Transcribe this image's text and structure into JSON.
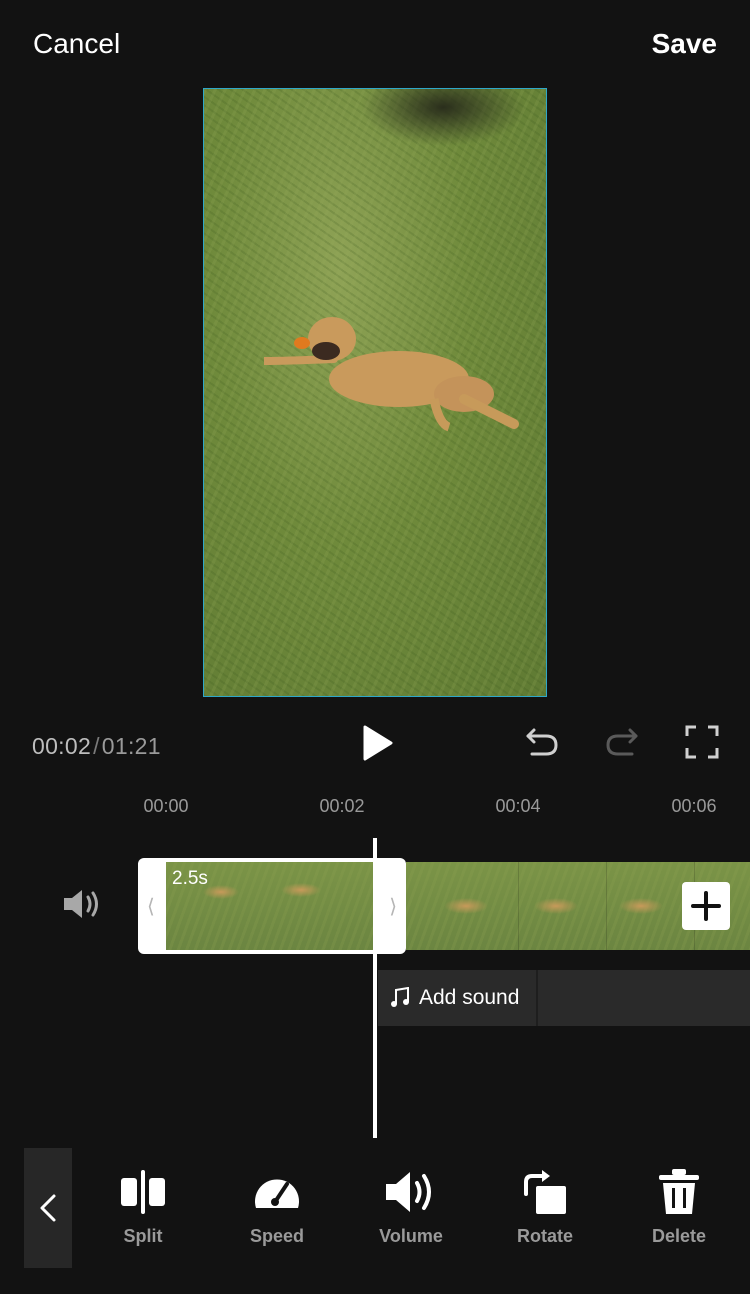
{
  "header": {
    "cancel_label": "Cancel",
    "save_label": "Save"
  },
  "playback": {
    "current_time": "00:02",
    "separator": "/",
    "total_time": "01:21"
  },
  "ruler": {
    "ticks": [
      "00:00",
      "00:02",
      "00:04",
      "00:06"
    ]
  },
  "timeline": {
    "clip_duration": "2.5s",
    "add_sound_label": "Add sound"
  },
  "toolbar": {
    "items": [
      {
        "label": "Split",
        "icon": "split-icon"
      },
      {
        "label": "Speed",
        "icon": "speed-icon"
      },
      {
        "label": "Volume",
        "icon": "volume-icon"
      },
      {
        "label": "Rotate",
        "icon": "rotate-icon"
      },
      {
        "label": "Delete",
        "icon": "trash-icon"
      }
    ]
  },
  "colors": {
    "background": "#121212",
    "preview_border": "#2ea7c9",
    "muted_text": "#9a9a9a",
    "panel": "#2a2a2a"
  }
}
